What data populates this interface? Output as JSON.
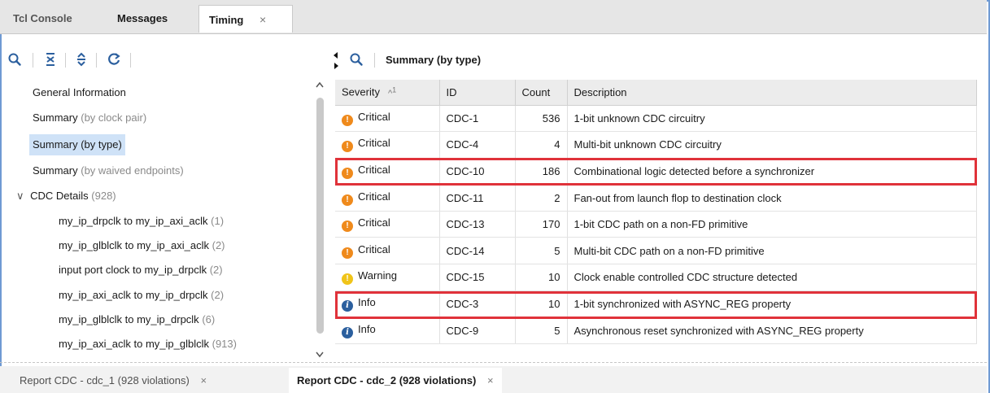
{
  "top_tabs": [
    {
      "label": "Tcl Console"
    },
    {
      "label": "Messages"
    },
    {
      "label": "Timing",
      "close": "×"
    }
  ],
  "left_toolbar": {
    "icons": [
      "search-icon",
      "collapse-all-icon",
      "expand-all-icon",
      "refresh-icon"
    ]
  },
  "nav": {
    "general": "General Information",
    "clock_pair": {
      "main": "Summary",
      "muted": "(by clock pair)"
    },
    "by_type": "Summary (by type)",
    "waived": {
      "main": "Summary",
      "muted": "(by waived endpoints)"
    },
    "cdc_details": {
      "main": "CDC Details",
      "muted": "(928)",
      "chevron": "∨"
    },
    "children": [
      {
        "main": "my_ip_drpclk to my_ip_axi_aclk",
        "muted": "(1)"
      },
      {
        "main": "my_ip_glblclk to my_ip_axi_aclk",
        "muted": "(2)"
      },
      {
        "main": "input port clock to my_ip_drpclk",
        "muted": "(2)"
      },
      {
        "main": "my_ip_axi_aclk to my_ip_drpclk",
        "muted": "(2)"
      },
      {
        "main": "my_ip_glblclk to my_ip_drpclk",
        "muted": "(6)"
      },
      {
        "main": "my_ip_axi_aclk to my_ip_glblclk",
        "muted": "(913)"
      }
    ]
  },
  "right_panel": {
    "title": "Summary (by type)"
  },
  "table": {
    "columns": {
      "severity": "Severity",
      "sort": "^",
      "sort_order": "1",
      "id": "ID",
      "count": "Count",
      "description": "Description"
    },
    "rows": [
      {
        "severity": "Critical",
        "level": "crit",
        "glyph": "!",
        "id": "CDC-1",
        "count": "536",
        "description": "1-bit unknown CDC circuitry"
      },
      {
        "severity": "Critical",
        "level": "crit",
        "glyph": "!",
        "id": "CDC-4",
        "count": "4",
        "description": "Multi-bit unknown CDC circuitry"
      },
      {
        "severity": "Critical",
        "level": "crit",
        "glyph": "!",
        "id": "CDC-10",
        "count": "186",
        "description": "Combinational logic detected before a synchronizer"
      },
      {
        "severity": "Critical",
        "level": "crit",
        "glyph": "!",
        "id": "CDC-11",
        "count": "2",
        "description": "Fan-out from launch flop to destination clock"
      },
      {
        "severity": "Critical",
        "level": "crit",
        "glyph": "!",
        "id": "CDC-13",
        "count": "170",
        "description": "1-bit CDC path on a non-FD primitive"
      },
      {
        "severity": "Critical",
        "level": "crit",
        "glyph": "!",
        "id": "CDC-14",
        "count": "5",
        "description": "Multi-bit CDC path on a non-FD primitive"
      },
      {
        "severity": "Warning",
        "level": "warn",
        "glyph": "!",
        "id": "CDC-15",
        "count": "10",
        "description": "Clock enable controlled CDC structure detected"
      },
      {
        "severity": "Info",
        "level": "info",
        "glyph": "i",
        "id": "CDC-3",
        "count": "10",
        "description": "1-bit synchronized with ASYNC_REG property"
      },
      {
        "severity": "Info",
        "level": "info",
        "glyph": "i",
        "id": "CDC-9",
        "count": "5",
        "description": "Asynchronous reset synchronized with ASYNC_REG property"
      }
    ]
  },
  "bottom_tabs": [
    {
      "label": "Report CDC - cdc_1 (928 violations)",
      "close": "×"
    },
    {
      "label": "Report CDC - cdc_2 (928 violations)",
      "close": "×"
    }
  ],
  "colors": {
    "accent_border": "#6f9ad3",
    "selection": "#cfe2f7",
    "critical": "#ef8a1c",
    "warning": "#f0c419",
    "info": "#2b5f9e",
    "highlight_box": "#e0323a"
  }
}
